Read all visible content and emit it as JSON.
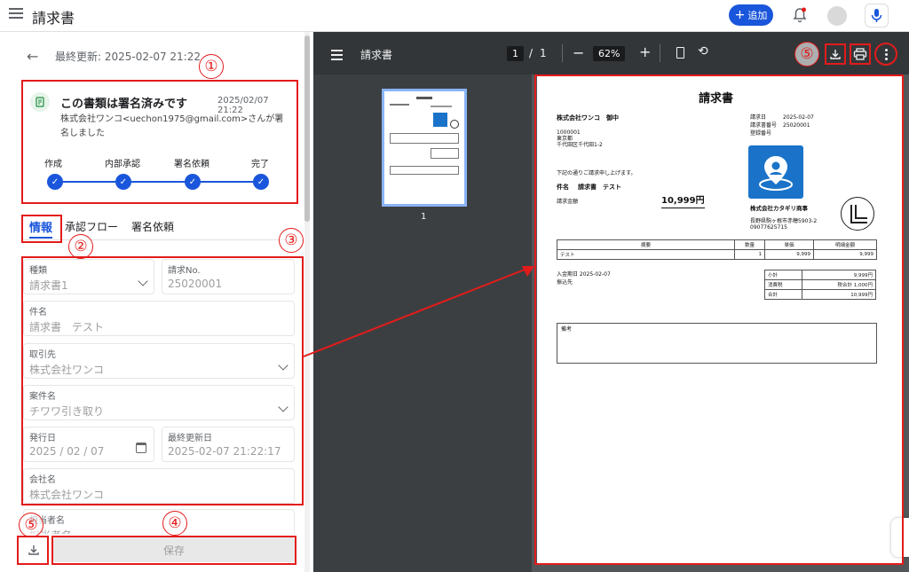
{
  "topbar": {
    "title": "請求書",
    "add_label": "追加"
  },
  "left": {
    "last_updated": "最終更新: 2025-02-07 21:22",
    "status_card": {
      "title": "この書類は署名済みです",
      "date": "2025/02/07 21:22",
      "message": "株式会社ワンコ<uechon1975@gmail.com>さんが署名しました",
      "steps": [
        "作成",
        "内部承認",
        "署名依頼",
        "完了"
      ]
    },
    "tabs": [
      "情報",
      "承認フロー",
      "署名依頼"
    ],
    "fields": {
      "kind": {
        "label": "種類",
        "value": "請求書1"
      },
      "invoice_no": {
        "label": "請求No.",
        "value": "25020001"
      },
      "subject": {
        "label": "件名",
        "value": "請求書　テスト"
      },
      "client": {
        "label": "取引先",
        "value": "株式会社ワンコ"
      },
      "project": {
        "label": "案件名",
        "value": "チワワ引き取り"
      },
      "issue_date": {
        "label": "発行日",
        "value": "2025 / 02 / 07"
      },
      "last_modified": {
        "label": "最終更新日",
        "value": "2025-02-07 21:22:17"
      },
      "company": {
        "label": "会社名",
        "value": "株式会社ワンコ"
      },
      "person": {
        "label": "担当者名",
        "value": "担当者名"
      }
    },
    "save_label": "保存"
  },
  "annotations": [
    "①",
    "②",
    "③",
    "④",
    "⑤",
    "⑤"
  ],
  "viewer": {
    "title": "請求書",
    "page_current": "1",
    "page_sep": "/",
    "page_total": "1",
    "zoom": "62%",
    "thumb_label": "1"
  },
  "doc": {
    "heading": "請求書",
    "to": "株式会社ワンコ　御中",
    "postal": "1000001",
    "addr1": "東京都",
    "addr2": "千代田区千代田1-2",
    "meta_date_label": "請求日",
    "meta_date": "2025-02-07",
    "meta_no_label": "請求書番号",
    "meta_no": "25020001",
    "meta_reg_label": "登録番号",
    "intro": "下記の通りご請求申し上げます。",
    "subject_label": "件名",
    "subject": "請求書　テスト",
    "amount_label": "請求金額",
    "amount": "10,999円",
    "issuer": "株式会社カタギリ商事",
    "issuer_addr": "長野県駒ヶ根市赤穂5903-2",
    "issuer_tel": "09077625715",
    "table_headers": [
      "摘要",
      "数量",
      "単価",
      "明細金額"
    ],
    "items": [
      {
        "name": "テスト",
        "qty": "1",
        "price": "9,999",
        "total": "9,999"
      }
    ],
    "due": "入金期日 2025-02-07",
    "bank": "振込先",
    "summary": [
      {
        "label": "小計",
        "value": "9,999円"
      },
      {
        "label": "消費税",
        "value": "税合計 1,000円"
      },
      {
        "label": "合計",
        "value": "10,999円"
      }
    ],
    "notes_label": "備考"
  }
}
